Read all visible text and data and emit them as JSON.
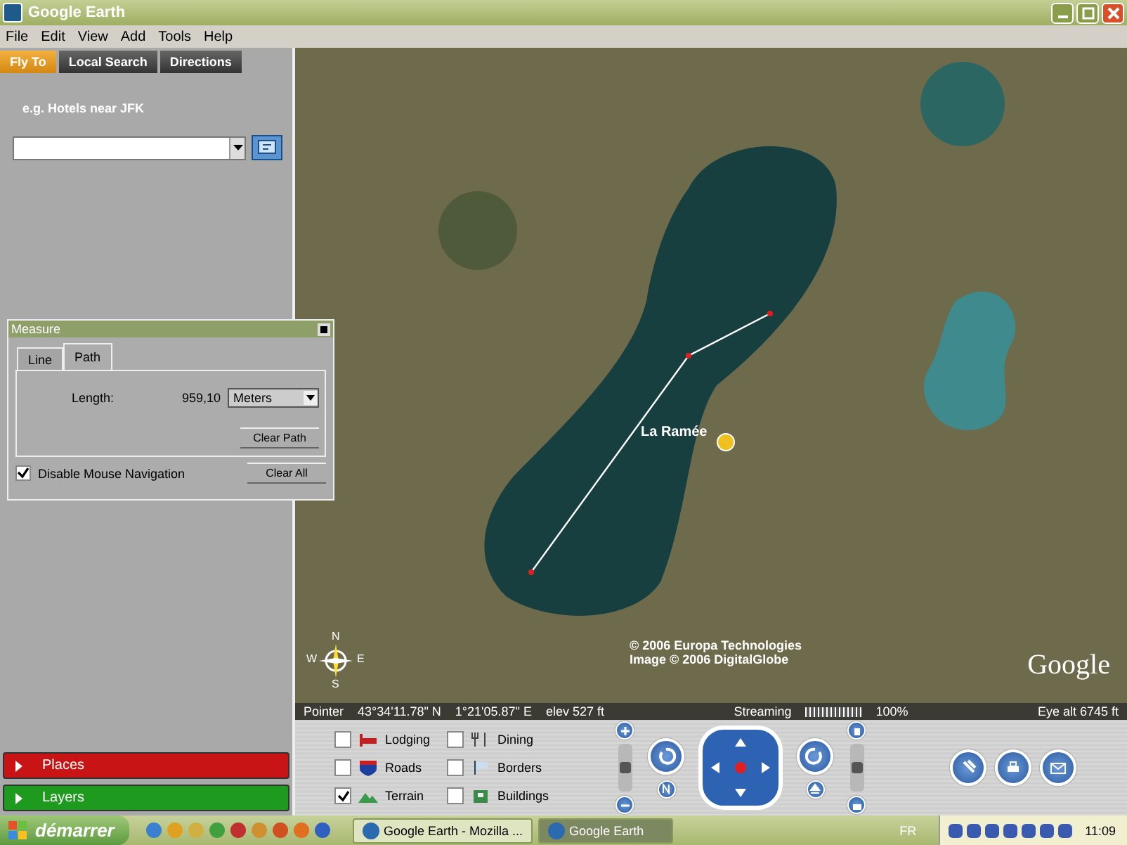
{
  "window": {
    "title": "Google Earth"
  },
  "menu": [
    "File",
    "Edit",
    "View",
    "Add",
    "Tools",
    "Help"
  ],
  "tabs": [
    {
      "label": "Fly To",
      "selected": true
    },
    {
      "label": "Local Search",
      "selected": false
    },
    {
      "label": "Directions",
      "selected": false
    }
  ],
  "search": {
    "hint": "e.g. Hotels near JFK"
  },
  "panels": [
    {
      "label": "Places",
      "color": "#c81414"
    },
    {
      "label": "Layers",
      "color": "#1e9a1e"
    }
  ],
  "measure": {
    "title": "Measure",
    "tabs": [
      {
        "label": "Line",
        "selected": false
      },
      {
        "label": "Path",
        "selected": true
      }
    ],
    "length_label": "Length:",
    "length_value": "959,10",
    "units": "Meters",
    "clear_path": "Clear Path",
    "clear_all": "Clear All",
    "mouse_nav": {
      "label": "Disable Mouse Navigation",
      "checked": true
    }
  },
  "map": {
    "placemark": "La Ramée",
    "compass": {
      "n": "N",
      "s": "S",
      "e": "E",
      "w": "W"
    },
    "copyright": [
      "© 2006 Europa Technologies",
      "Image © 2006 DigitalGlobe"
    ],
    "logo": "Google"
  },
  "status_bar": {
    "pointer_label": "Pointer",
    "lat": "43°34'11.78\"  N",
    "lon": "1°21'05.87\"  E",
    "elev": "elev  527 ft",
    "streaming": "Streaming",
    "level": 1,
    "percent": "100%",
    "eye_alt": "Eye alt      6745 ft"
  },
  "layers": [
    {
      "kind": "lodging",
      "label": "Lodging",
      "checked": false
    },
    {
      "kind": "roads",
      "label": "Roads",
      "checked": false
    },
    {
      "kind": "terrain",
      "label": "Terrain",
      "checked": true
    },
    {
      "kind": "dining",
      "label": "Dining",
      "checked": false
    },
    {
      "kind": "borders",
      "label": "Borders",
      "checked": false
    },
    {
      "kind": "buildings",
      "label": "Buildings",
      "checked": false
    }
  ],
  "zoom_slider": {
    "level": 0.5
  },
  "tilt_slider": {
    "level": 0.5
  },
  "taskbar": {
    "start": "démarrer",
    "tasks": [
      {
        "label": "Google Earth - Mozilla ...",
        "selected": false
      },
      {
        "label": "Google Earth",
        "selected": true
      }
    ],
    "language": "FR",
    "clock": "11:09"
  }
}
